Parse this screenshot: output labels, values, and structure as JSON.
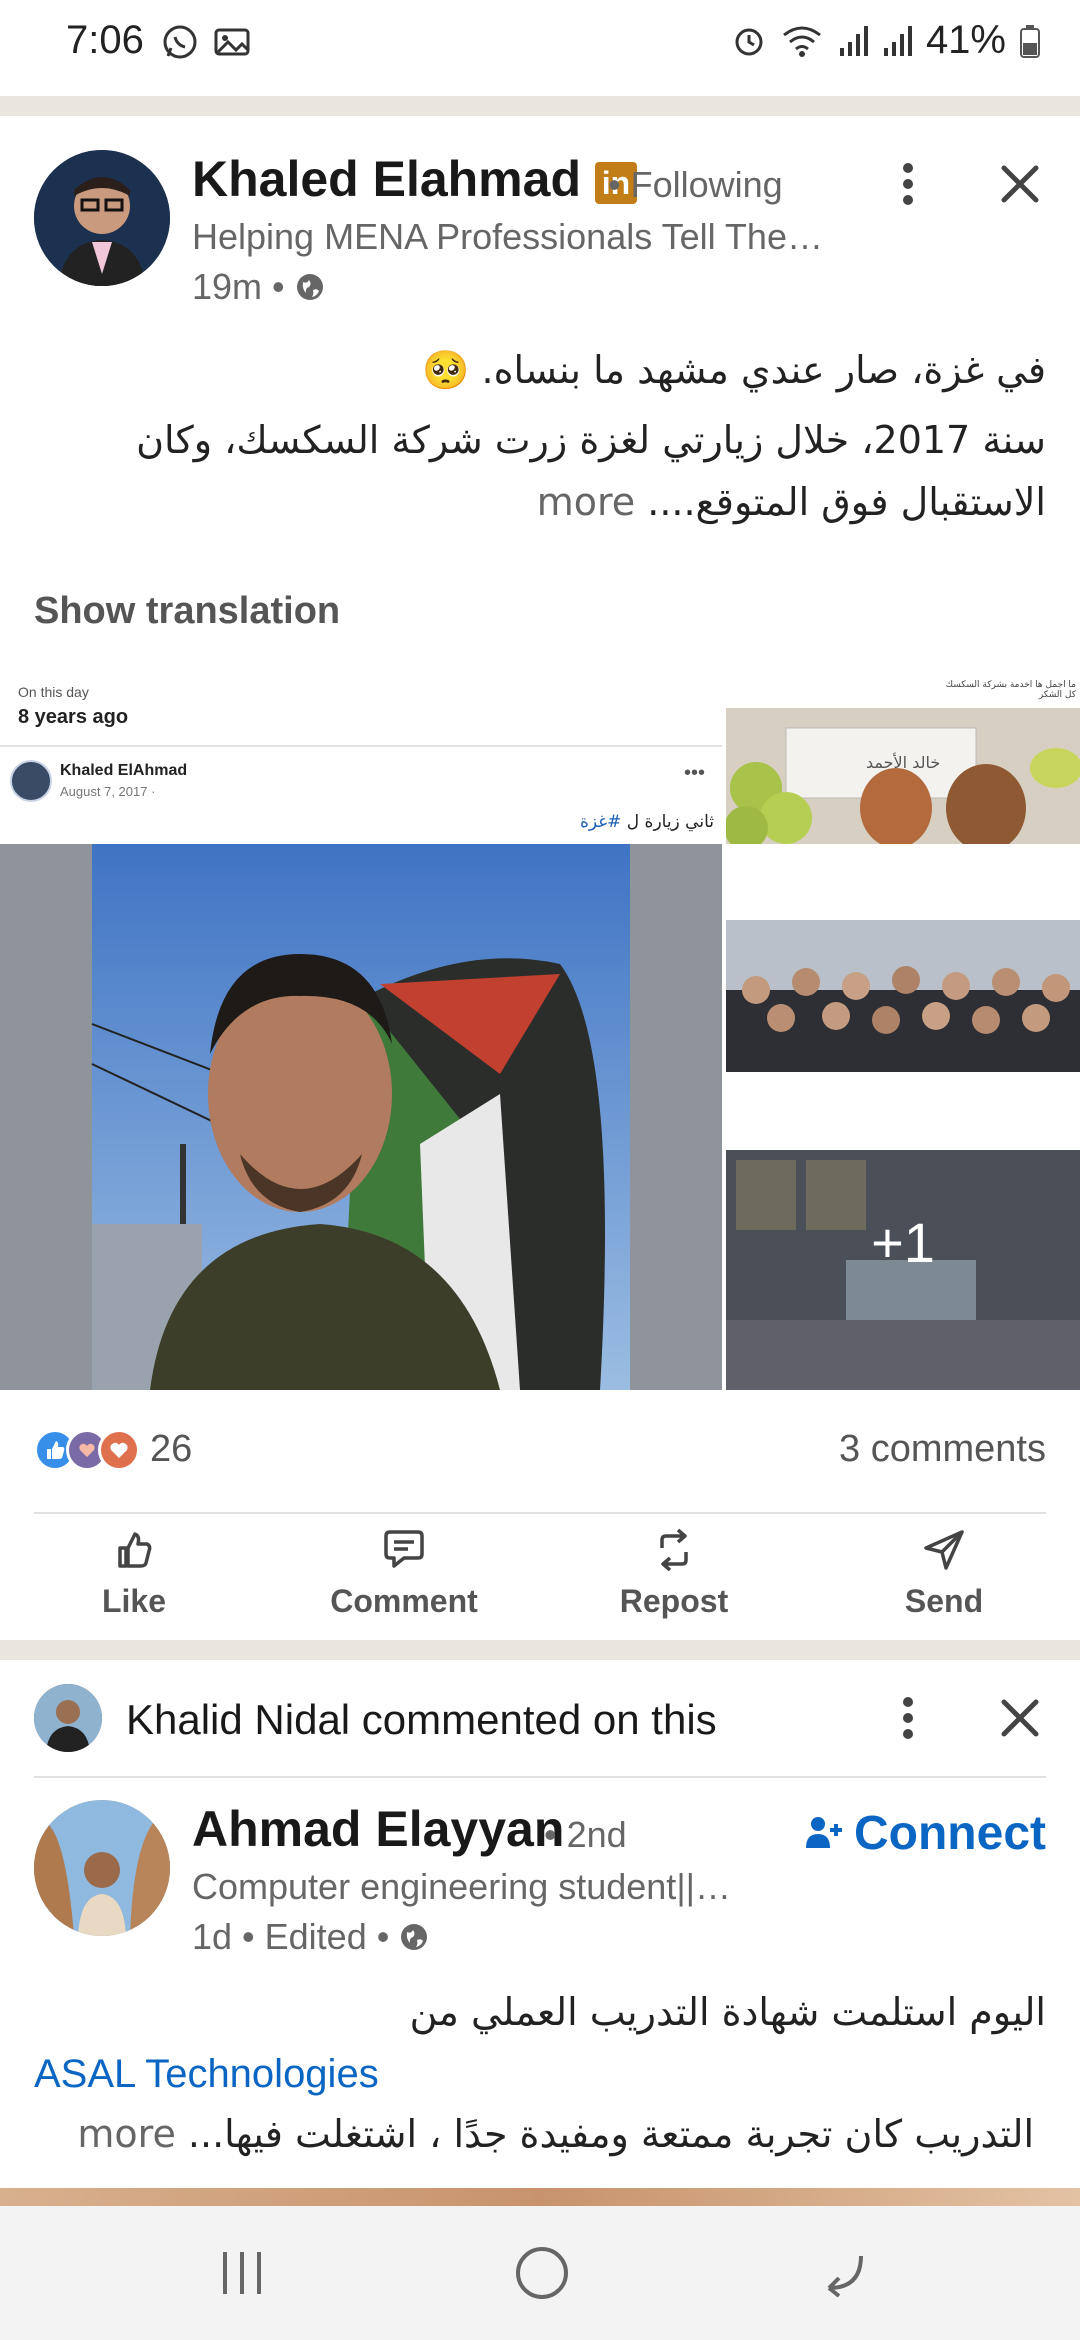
{
  "status_bar": {
    "time": "7:06",
    "battery": "41%",
    "icons": [
      "whatsapp-icon",
      "gallery-icon",
      "alarm-icon",
      "wifi-icon",
      "signal-icon",
      "signal-icon",
      "battery-icon"
    ]
  },
  "post1": {
    "author": "Khaled Elahmad",
    "badge": "in",
    "follow_state": "• Following",
    "headline": "Helping MENA Professionals Tell The…",
    "time": "19m •",
    "text_line1": "في غزة، صار عندي مشهد ما بنساه. 🥺",
    "text_line2": "سنة 2017، خلال زيارتي لغزة زرت شركة السكسك، وكان",
    "text_line3": "الاستقبال فوق المتوقع....",
    "more_label": "more",
    "show_translation": "Show translation",
    "memory": {
      "label": "On this day",
      "years": "8 years ago",
      "fb_name": "Khaled ElAhmad",
      "fb_date": "August 7, 2017 · ",
      "fb_caption_text": "ثاني زيارة ل ",
      "fb_caption_tag": "#غزة",
      "side_caption": "ما اجمل ها اخدمة بشركة السكسك كل الشكر",
      "name_card_text": "خالد الأحمد",
      "extra_count": "+1"
    },
    "reaction_count": "26",
    "comments": "3 comments",
    "actions": {
      "like": "Like",
      "comment": "Comment",
      "repost": "Repost",
      "send": "Send"
    }
  },
  "post2": {
    "commenter": "Khalid Nidal",
    "commented_text": " commented on this",
    "author": "Ahmad Elayyan",
    "degree": "• 2nd",
    "connect_label": "Connect",
    "headline": "Computer engineering student||…",
    "time": "1d • Edited •",
    "text_line1": "اليوم استلمت شهادة التدريب العملي من",
    "mention": "ASAL Technologies",
    "text_line3": "التدريب كان تجربة ممتعة ومفيدة جدًا ، اشتغلت فيها...",
    "more_label": "more"
  },
  "colors": {
    "linkedin_blue": "#0a66c2",
    "premium_gold": "#c37d16",
    "divider": "#e9e5df"
  }
}
